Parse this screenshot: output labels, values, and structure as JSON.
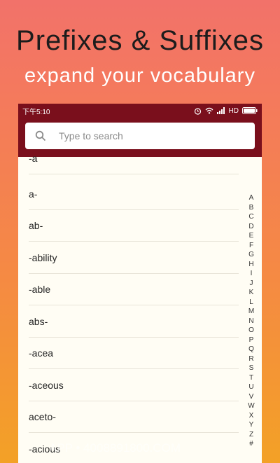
{
  "promo": {
    "title": "Prefixes & Suffixes",
    "subtitle": "expand your vocabulary"
  },
  "statusbar": {
    "time": "下午5:10",
    "network": "HD"
  },
  "search": {
    "placeholder": "Type to search"
  },
  "list": {
    "items": [
      "-a",
      "a-",
      "ab-",
      "-ability",
      "-able",
      "abs-",
      "-acea",
      "-aceous",
      "aceto-",
      "-acious"
    ]
  },
  "index": {
    "letters": [
      "A",
      "B",
      "C",
      "D",
      "E",
      "F",
      "G",
      "H",
      "I",
      "J",
      "K",
      "L",
      "M",
      "N",
      "O",
      "P",
      "Q",
      "R",
      "S",
      "T",
      "U",
      "V",
      "W",
      "X",
      "Y",
      "Z",
      "#"
    ]
  },
  "watermark": "APP • 4008891800.COM",
  "colors": {
    "appbar": "#7a0f1c",
    "gradient_top": "#f2726a",
    "gradient_bottom": "#f3a126",
    "list_bg": "#fffdf4"
  }
}
